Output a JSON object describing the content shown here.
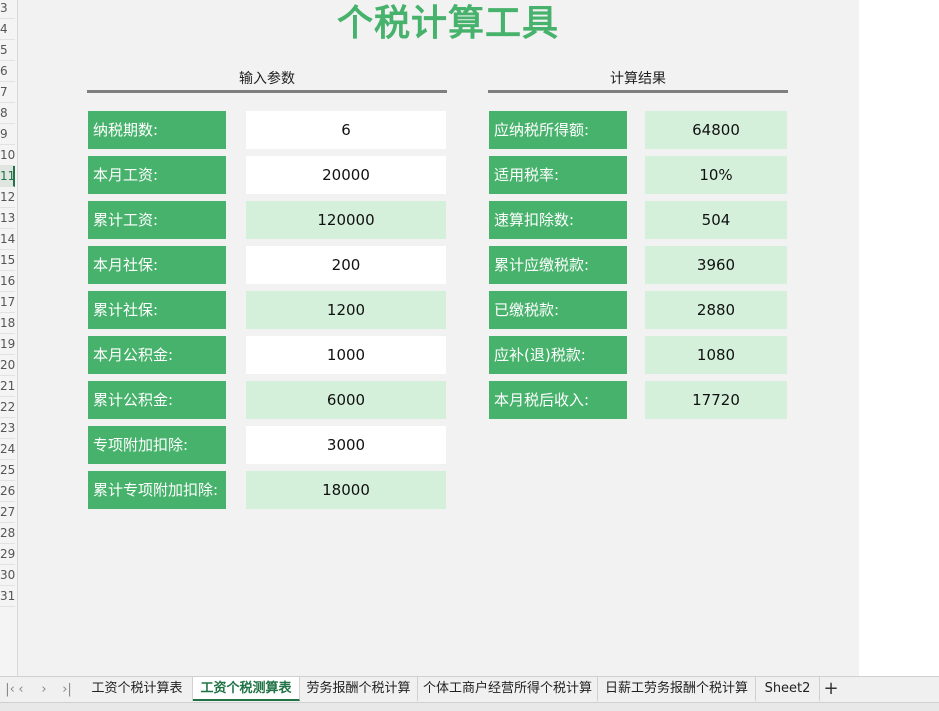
{
  "sheet": {
    "title": "个税计算工具"
  },
  "input": {
    "heading": "输入参数",
    "rows": [
      {
        "label": "纳税期数:",
        "value": "6",
        "kind": "editable"
      },
      {
        "label": "本月工资:",
        "value": "20000",
        "kind": "editable"
      },
      {
        "label": "累计工资:",
        "value": "120000",
        "kind": "computed"
      },
      {
        "label": "本月社保:",
        "value": "200",
        "kind": "editable"
      },
      {
        "label": "累计社保:",
        "value": "1200",
        "kind": "computed"
      },
      {
        "label": "本月公积金:",
        "value": "1000",
        "kind": "editable"
      },
      {
        "label": "累计公积金:",
        "value": "6000",
        "kind": "computed"
      },
      {
        "label": "专项附加扣除:",
        "value": "3000",
        "kind": "editable"
      },
      {
        "label": "累计专项附加扣除:",
        "value": "18000",
        "kind": "computed"
      }
    ]
  },
  "result": {
    "heading": "计算结果",
    "rows": [
      {
        "label": "应纳税所得额:",
        "value": "64800"
      },
      {
        "label": "适用税率:",
        "value": "10%"
      },
      {
        "label": "速算扣除数:",
        "value": "504"
      },
      {
        "label": "累计应缴税款:",
        "value": "3960"
      },
      {
        "label": "已缴税款:",
        "value": "2880"
      },
      {
        "label": "应补(退)税款:",
        "value": "1080"
      },
      {
        "label": "本月税后收入:",
        "value": "17720"
      }
    ]
  },
  "row_numbers": [
    "3",
    "4",
    "5",
    "6",
    "7",
    "8",
    "9",
    "10",
    "11",
    "12",
    "13",
    "14",
    "15",
    "16",
    "17",
    "18",
    "19",
    "20",
    "21",
    "22",
    "23",
    "24",
    "25",
    "26",
    "27",
    "28",
    "29",
    "30",
    "31"
  ],
  "active_row": "11",
  "tabs": [
    {
      "label": "工资个税计算表",
      "active": false
    },
    {
      "label": "工资个税测算表",
      "active": true
    },
    {
      "label": "劳务报酬个税计算",
      "active": false
    },
    {
      "label": "个体工商户经营所得个税计算",
      "active": false
    },
    {
      "label": "日薪工劳务报酬个税计算",
      "active": false
    },
    {
      "label": "Sheet2",
      "active": false
    }
  ],
  "tab_nav": {
    "first": "|‹",
    "prev": "‹",
    "next": "›",
    "last": "›|",
    "add": "+"
  },
  "colors": {
    "label_green": "#47b26c",
    "computed_fill": "#d5f0da",
    "active_tab": "#217346"
  }
}
